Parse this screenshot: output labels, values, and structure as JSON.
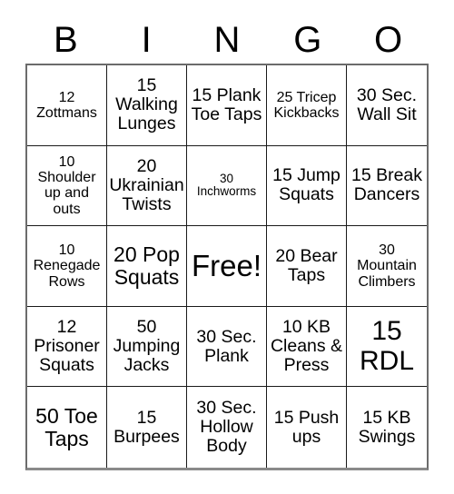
{
  "card": {
    "title_letters": [
      "B",
      "I",
      "N",
      "G",
      "O"
    ],
    "free_space_label": "Free!",
    "colors": {
      "background": "#ffffff",
      "text": "#000000",
      "grid_line": "#1a1a1a",
      "outer_border": "#6b6b6b"
    },
    "grid": {
      "columns": 5,
      "rows": 5,
      "cells": [
        {
          "text": "12 Zottmans",
          "size": "s"
        },
        {
          "text": "15 Walking Lunges",
          "size": "m"
        },
        {
          "text": "15 Plank Toe Taps",
          "size": "m"
        },
        {
          "text": "25 Tricep Kickbacks",
          "size": "s"
        },
        {
          "text": "30 Sec. Wall Sit",
          "size": "m"
        },
        {
          "text": "10 Shoulder up and outs",
          "size": "s"
        },
        {
          "text": "20 Ukrainian Twists",
          "size": "m"
        },
        {
          "text": "30 Inchworms",
          "size": "xs"
        },
        {
          "text": "15 Jump Squats",
          "size": "m"
        },
        {
          "text": "15 Break Dancers",
          "size": "m"
        },
        {
          "text": "10 Renegade Rows",
          "size": "s"
        },
        {
          "text": "20 Pop Squats",
          "size": "l"
        },
        {
          "text": "Free!",
          "size": "free"
        },
        {
          "text": "20 Bear Taps",
          "size": "m"
        },
        {
          "text": "30 Mountain Climbers",
          "size": "s"
        },
        {
          "text": "12 Prisoner Squats",
          "size": "m"
        },
        {
          "text": "50 Jumping Jacks",
          "size": "m"
        },
        {
          "text": "30 Sec. Plank",
          "size": "m"
        },
        {
          "text": "10 KB Cleans & Press",
          "size": "m"
        },
        {
          "text": "15 RDL",
          "size": "xl"
        },
        {
          "text": "50 Toe Taps",
          "size": "l"
        },
        {
          "text": "15 Burpees",
          "size": "m"
        },
        {
          "text": "30 Sec. Hollow Body",
          "size": "m"
        },
        {
          "text": "15 Push ups",
          "size": "m"
        },
        {
          "text": "15 KB Swings",
          "size": "m"
        }
      ]
    }
  }
}
